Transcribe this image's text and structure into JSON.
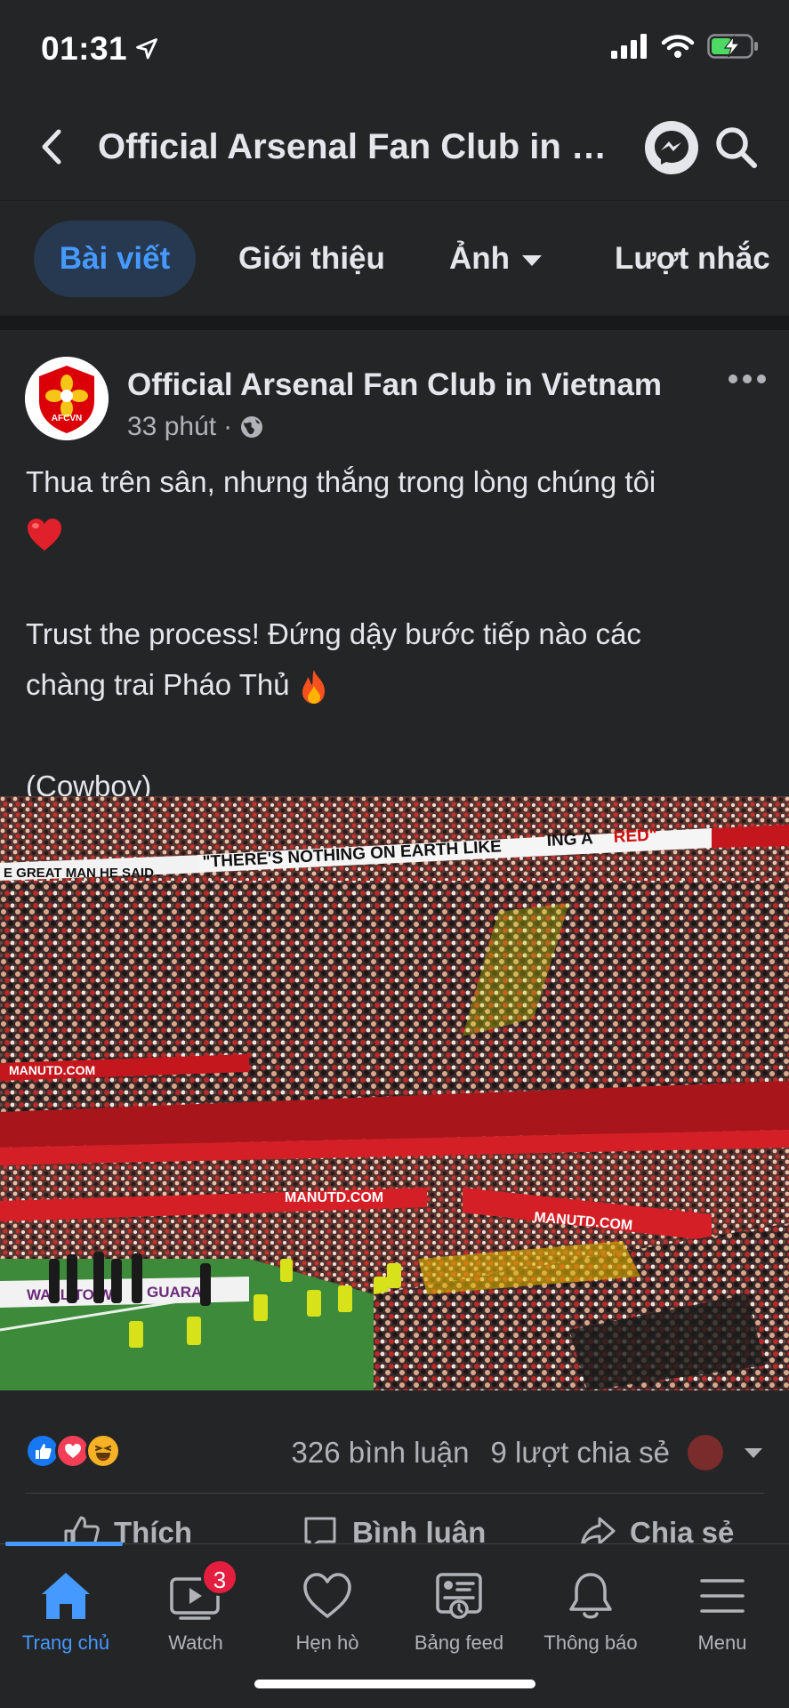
{
  "status_bar": {
    "time": "01:31"
  },
  "header": {
    "title": "Official Arsenal Fan Club in Vi..."
  },
  "tabs": [
    {
      "label": "Bài viết"
    },
    {
      "label": "Giới thiệu"
    },
    {
      "label": "Ảnh"
    },
    {
      "label": "Lượt nhắc"
    }
  ],
  "post": {
    "author": "Official Arsenal Fan Club in Vietnam",
    "avatar_text": "AFCVN",
    "time": "33 phút",
    "dot": "·",
    "text_lines": [
      "Thua trên sân, nhưng thắng trong lòng chúng tôi",
      "Trust the process! Đứng dậy bước tiếp nào các",
      "chàng trai Pháo Thủ",
      "(Cowboy)"
    ],
    "photo": {
      "banner_left": "E GREAT MAN HE SAID",
      "banner_main": "\"THERE'S NOTHING ON EARTH LIKE",
      "banner_end": "ING A",
      "banner_red": "RED\"",
      "board_1": "MANUTD.COM",
      "board_2": "MANUTD.COM",
      "board_3": "MANUTD.COM",
      "pitch_board": "WALL TO W",
      "pitch_board_2": "GUARA"
    },
    "comments": "326 bình luận",
    "shares": "9 lượt chia sẻ",
    "actions": {
      "like": "Thích",
      "comment": "Bình luận",
      "share": "Chia sẻ"
    }
  },
  "bottom_nav": [
    {
      "label": "Trang chủ",
      "icon": "home-icon"
    },
    {
      "label": "Watch",
      "icon": "watch-icon",
      "badge": "3"
    },
    {
      "label": "Hẹn hò",
      "icon": "heart-icon"
    },
    {
      "label": "Bảng feed",
      "icon": "feed-icon"
    },
    {
      "label": "Thông báo",
      "icon": "bell-icon"
    },
    {
      "label": "Menu",
      "icon": "menu-icon"
    }
  ],
  "colors": {
    "background": "#242526",
    "accent": "#4599ff",
    "tab_active_bg": "#263951",
    "badge": "#e41e3f",
    "battery_green": "#4cd964"
  }
}
